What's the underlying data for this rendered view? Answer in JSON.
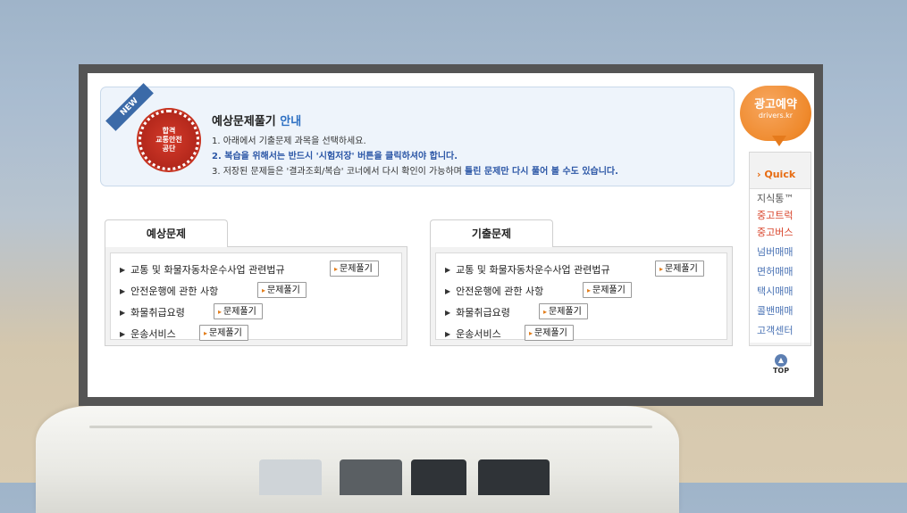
{
  "notice": {
    "ribbon": "NEW",
    "seal_lines": [
      "합격",
      "교통안전",
      "공단"
    ],
    "title_main": "예상문제풀기",
    "title_hl": "안내",
    "line1": "1. 아래에서 기출문제 과목을 선택하세요.",
    "line2": "2. 복습을 위해서는 반드시 '시험저장' 버튼을 클릭하셔야 합니다.",
    "line3_pre": "3. 저장된 문제들은 '결과조회/복습' 코너에서 다시 확인이 가능하며",
    "line3_bold": "틀린 문제만 다시 풀어 볼 수도 있습니다."
  },
  "sections": [
    {
      "tab": "예상문제",
      "items": [
        {
          "label": "교통 및 화물자동차운수사업 관련법규",
          "button": "문제풀기"
        },
        {
          "label": "안전운행에 관한 사항",
          "button": "문제풀기"
        },
        {
          "label": "화물취급요령",
          "button": "문제풀기"
        },
        {
          "label": "운송서비스",
          "button": "문제풀기"
        }
      ]
    },
    {
      "tab": "기출문제",
      "items": [
        {
          "label": "교통 및 화물자동차운수사업 관련법규",
          "button": "문제풀기"
        },
        {
          "label": "안전운행에 관한 사항",
          "button": "문제풀기"
        },
        {
          "label": "화물취급요령",
          "button": "문제풀기"
        },
        {
          "label": "운송서비스",
          "button": "문제풀기"
        }
      ]
    }
  ],
  "ad_badge": {
    "title": "광고예약",
    "sub": "drivers.kr"
  },
  "quick": {
    "head": "Quick",
    "items": [
      {
        "label": "지식통™",
        "color": "#555555"
      },
      {
        "label": "중고트럭",
        "color": "#d8432a"
      },
      {
        "label": "중고버스",
        "color": "#d8432a"
      },
      {
        "label": "넘버매매",
        "color": "#4a73b5"
      },
      {
        "label": "면허매매",
        "color": "#4a73b5"
      },
      {
        "label": "택시매매",
        "color": "#4a73b5"
      },
      {
        "label": "콜밴매매",
        "color": "#4a73b5"
      },
      {
        "label": "고객센터",
        "color": "#4a73b5"
      }
    ],
    "top_label": "TOP"
  }
}
